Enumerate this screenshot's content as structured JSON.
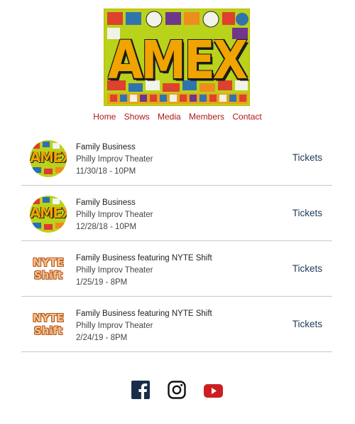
{
  "logo": {
    "text": "AMEX"
  },
  "nav": {
    "items": [
      "Home",
      "Shows",
      "Media",
      "Members",
      "Contact"
    ]
  },
  "shows": [
    {
      "thumb": "amex",
      "title": "Family Business",
      "venue": "Philly Improv Theater",
      "date": "11/30/18 - 10PM",
      "tickets_label": "Tickets"
    },
    {
      "thumb": "amex",
      "title": "Family Business",
      "venue": "Philly Improv Theater",
      "date": "12/28/18 - 10PM",
      "tickets_label": "Tickets"
    },
    {
      "thumb": "nyte",
      "title": "Family Business featuring NYTE Shift",
      "venue": "Philly Improv Theater",
      "date": "1/25/19 - 8PM",
      "tickets_label": "Tickets"
    },
    {
      "thumb": "nyte",
      "title": "Family Business featuring NYTE Shift",
      "venue": "Philly Improv Theater",
      "date": "2/24/19 - 8PM",
      "tickets_label": "Tickets"
    }
  ],
  "thumb_text": {
    "amex": "AMEX",
    "nyte_line1": "NYTE",
    "nyte_line2": "Shift"
  },
  "social": {
    "icons": [
      "facebook-icon",
      "instagram-icon",
      "youtube-icon"
    ]
  },
  "colors": {
    "nav_link": "#b01818",
    "tickets_link": "#1d3a5a",
    "logo_yellow": "#f0a400",
    "divider": "#c9c9c9",
    "youtube_red": "#cc1f1f",
    "facebook": "#1a2d4a"
  }
}
